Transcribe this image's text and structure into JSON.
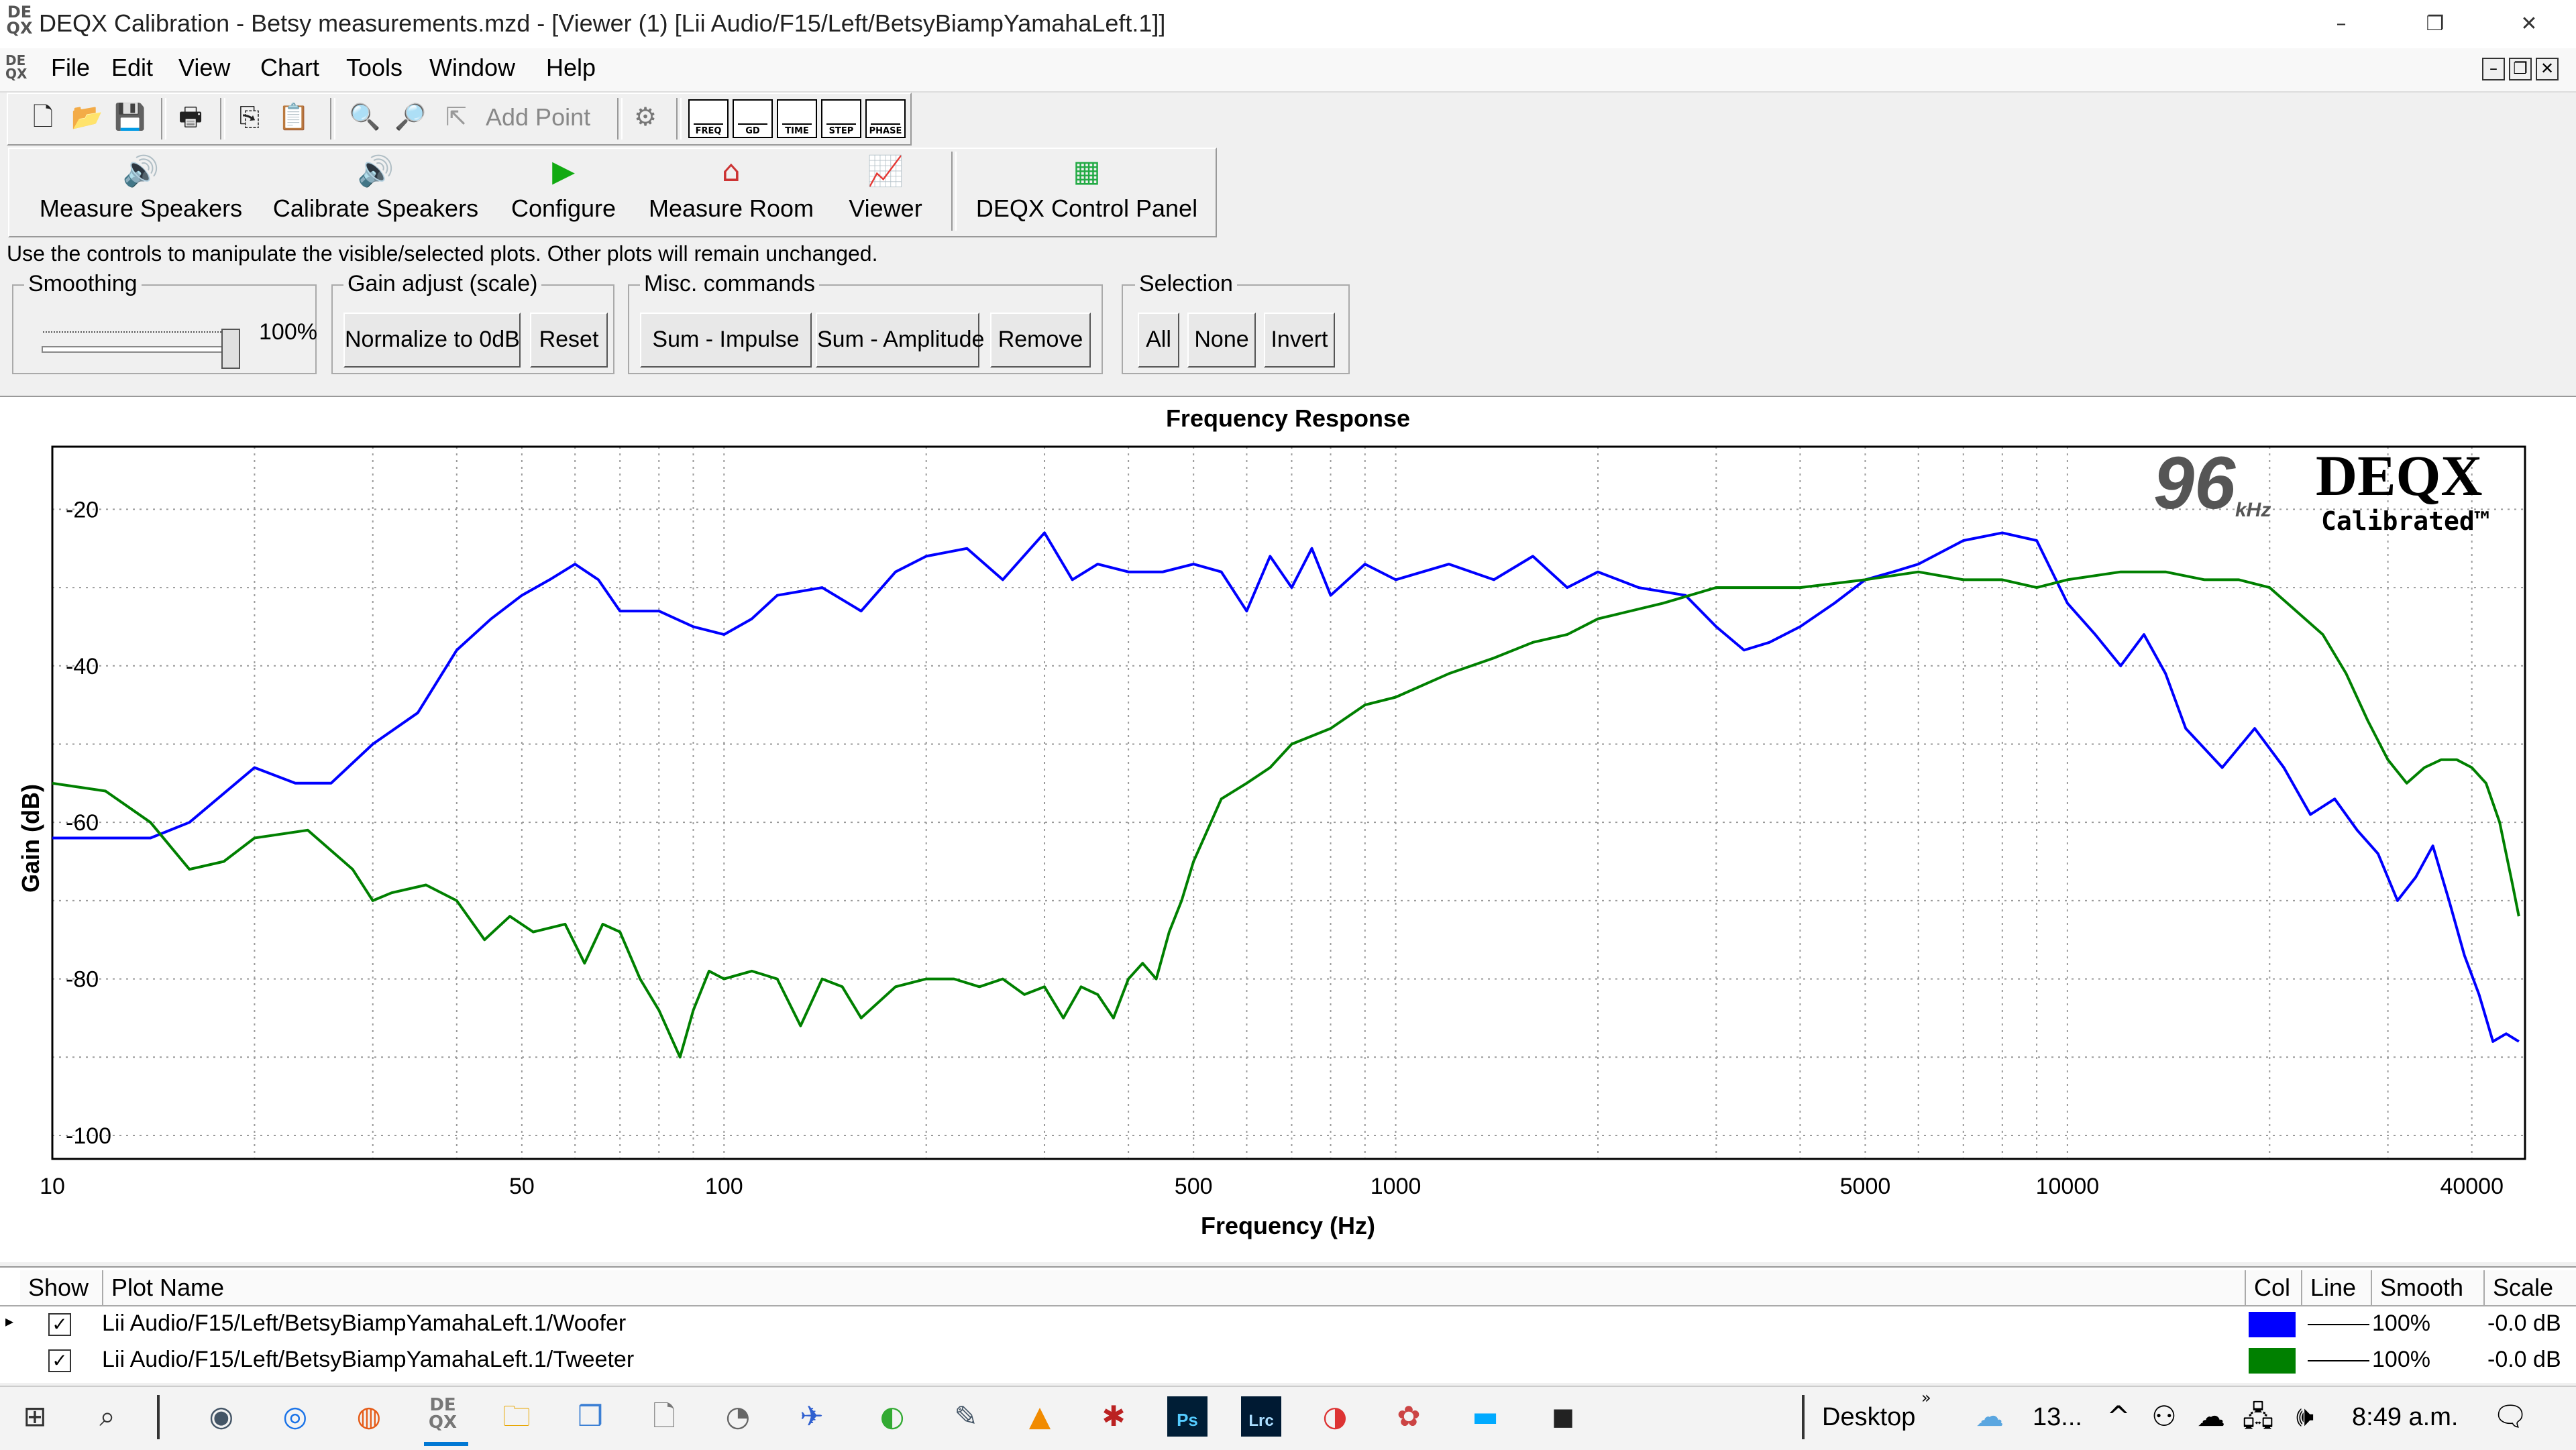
{
  "window": {
    "title": "DEQX Calibration - Betsy measurements.mzd - [Viewer (1) [Lii Audio/F15/Left/BetsyBiampYamahaLeft.1]]",
    "app_icon_text": "DE QX",
    "controls": [
      "–",
      "❐",
      "✕"
    ]
  },
  "menu": [
    "File",
    "Edit",
    "View",
    "Chart",
    "Tools",
    "Window",
    "Help"
  ],
  "toolbar": {
    "add_point_label": "Add Point",
    "view_buttons": [
      "FREQ",
      "GD",
      "TIME",
      "STEP",
      "PHASE"
    ]
  },
  "actions": [
    "Measure Speakers",
    "Calibrate Speakers",
    "Configure",
    "Measure Room",
    "Viewer",
    "DEQX Control Panel"
  ],
  "hint": "Use the controls to manipulate the visible/selected plots.  Other plots will remain unchanged.",
  "smoothing": {
    "title": "Smoothing",
    "value_label": "100%",
    "value": 1.0
  },
  "gain": {
    "title": "Gain adjust (scale)",
    "normalize": "Normalize to 0dB",
    "reset": "Reset"
  },
  "misc": {
    "title": "Misc. commands",
    "sum_impulse": "Sum - Impulse",
    "sum_amplitude": "Sum - Amplitude",
    "remove": "Remove"
  },
  "selection": {
    "title": "Selection",
    "all": "All",
    "none": "None",
    "invert": "Invert"
  },
  "chart_data": {
    "type": "line",
    "title": "Frequency Response",
    "xlabel": "Frequency (Hz)",
    "ylabel": "Gain (dB)",
    "x_scale": "log",
    "xlim": [
      10,
      48000
    ],
    "ylim": [
      -103,
      -12
    ],
    "x_ticks": [
      10,
      50,
      100,
      500,
      1000,
      5000,
      10000,
      40000
    ],
    "y_ticks": [
      -20,
      -40,
      -60,
      -80,
      -100
    ],
    "grid": true,
    "badge": {
      "rate": "96",
      "unit": "kHz",
      "brand": "DEQX",
      "sub": "Calibrated™"
    },
    "series": [
      {
        "name": "Lii Audio/F15/Left/BetsyBiampYamahaLeft.1/Woofer",
        "color": "#0000ff",
        "points": [
          [
            10,
            -62
          ],
          [
            14,
            -62
          ],
          [
            16,
            -60
          ],
          [
            20,
            -53
          ],
          [
            23,
            -55
          ],
          [
            26,
            -55
          ],
          [
            30,
            -50
          ],
          [
            35,
            -46
          ],
          [
            40,
            -38
          ],
          [
            45,
            -34
          ],
          [
            50,
            -31
          ],
          [
            55,
            -29
          ],
          [
            60,
            -27
          ],
          [
            65,
            -29
          ],
          [
            70,
            -33
          ],
          [
            80,
            -33
          ],
          [
            90,
            -35
          ],
          [
            100,
            -36
          ],
          [
            110,
            -34
          ],
          [
            120,
            -31
          ],
          [
            140,
            -30
          ],
          [
            160,
            -33
          ],
          [
            180,
            -28
          ],
          [
            200,
            -26
          ],
          [
            230,
            -25
          ],
          [
            260,
            -29
          ],
          [
            300,
            -23
          ],
          [
            330,
            -29
          ],
          [
            360,
            -27
          ],
          [
            400,
            -28
          ],
          [
            450,
            -28
          ],
          [
            500,
            -27
          ],
          [
            550,
            -28
          ],
          [
            600,
            -33
          ],
          [
            650,
            -26
          ],
          [
            700,
            -30
          ],
          [
            750,
            -25
          ],
          [
            800,
            -31
          ],
          [
            900,
            -27
          ],
          [
            1000,
            -29
          ],
          [
            1200,
            -27
          ],
          [
            1400,
            -29
          ],
          [
            1600,
            -26
          ],
          [
            1800,
            -30
          ],
          [
            2000,
            -28
          ],
          [
            2300,
            -30
          ],
          [
            2700,
            -31
          ],
          [
            3000,
            -35
          ],
          [
            3300,
            -38
          ],
          [
            3600,
            -37
          ],
          [
            4000,
            -35
          ],
          [
            4500,
            -32
          ],
          [
            5000,
            -29
          ],
          [
            5500,
            -28
          ],
          [
            6000,
            -27
          ],
          [
            7000,
            -24
          ],
          [
            8000,
            -23
          ],
          [
            9000,
            -24
          ],
          [
            10000,
            -32
          ],
          [
            11000,
            -36
          ],
          [
            12000,
            -40
          ],
          [
            13000,
            -36
          ],
          [
            14000,
            -41
          ],
          [
            15000,
            -48
          ],
          [
            17000,
            -53
          ],
          [
            19000,
            -48
          ],
          [
            21000,
            -53
          ],
          [
            23000,
            -59
          ],
          [
            25000,
            -57
          ],
          [
            27000,
            -61
          ],
          [
            29000,
            -64
          ],
          [
            31000,
            -70
          ],
          [
            33000,
            -67
          ],
          [
            35000,
            -63
          ],
          [
            37000,
            -70
          ],
          [
            39000,
            -77
          ],
          [
            41000,
            -82
          ],
          [
            43000,
            -88
          ],
          [
            45000,
            -87
          ],
          [
            47000,
            -88
          ]
        ]
      },
      {
        "name": "Lii Audio/F15/Left/BetsyBiampYamahaLeft.1/Tweeter",
        "color": "#008000",
        "points": [
          [
            10,
            -55
          ],
          [
            12,
            -56
          ],
          [
            14,
            -60
          ],
          [
            16,
            -66
          ],
          [
            18,
            -65
          ],
          [
            20,
            -62
          ],
          [
            24,
            -61
          ],
          [
            28,
            -66
          ],
          [
            30,
            -70
          ],
          [
            32,
            -69
          ],
          [
            36,
            -68
          ],
          [
            40,
            -70
          ],
          [
            44,
            -75
          ],
          [
            48,
            -72
          ],
          [
            52,
            -74
          ],
          [
            58,
            -73
          ],
          [
            62,
            -78
          ],
          [
            66,
            -73
          ],
          [
            70,
            -74
          ],
          [
            75,
            -80
          ],
          [
            80,
            -84
          ],
          [
            86,
            -90
          ],
          [
            90,
            -84
          ],
          [
            95,
            -79
          ],
          [
            100,
            -80
          ],
          [
            110,
            -79
          ],
          [
            120,
            -80
          ],
          [
            130,
            -86
          ],
          [
            140,
            -80
          ],
          [
            150,
            -81
          ],
          [
            160,
            -85
          ],
          [
            180,
            -81
          ],
          [
            200,
            -80
          ],
          [
            220,
            -80
          ],
          [
            240,
            -81
          ],
          [
            260,
            -80
          ],
          [
            280,
            -82
          ],
          [
            300,
            -81
          ],
          [
            320,
            -85
          ],
          [
            340,
            -81
          ],
          [
            360,
            -82
          ],
          [
            380,
            -85
          ],
          [
            400,
            -80
          ],
          [
            420,
            -78
          ],
          [
            440,
            -80
          ],
          [
            460,
            -74
          ],
          [
            480,
            -70
          ],
          [
            500,
            -65
          ],
          [
            550,
            -57
          ],
          [
            600,
            -55
          ],
          [
            650,
            -53
          ],
          [
            700,
            -50
          ],
          [
            800,
            -48
          ],
          [
            900,
            -45
          ],
          [
            1000,
            -44
          ],
          [
            1200,
            -41
          ],
          [
            1400,
            -39
          ],
          [
            1600,
            -37
          ],
          [
            1800,
            -36
          ],
          [
            2000,
            -34
          ],
          [
            2500,
            -32
          ],
          [
            3000,
            -30
          ],
          [
            4000,
            -30
          ],
          [
            5000,
            -29
          ],
          [
            6000,
            -28
          ],
          [
            7000,
            -29
          ],
          [
            8000,
            -29
          ],
          [
            9000,
            -30
          ],
          [
            10000,
            -29
          ],
          [
            12000,
            -28
          ],
          [
            14000,
            -28
          ],
          [
            16000,
            -29
          ],
          [
            18000,
            -29
          ],
          [
            20000,
            -30
          ],
          [
            24000,
            -36
          ],
          [
            26000,
            -41
          ],
          [
            28000,
            -47
          ],
          [
            30000,
            -52
          ],
          [
            32000,
            -55
          ],
          [
            34000,
            -53
          ],
          [
            36000,
            -52
          ],
          [
            38000,
            -52
          ],
          [
            40000,
            -53
          ],
          [
            42000,
            -55
          ],
          [
            44000,
            -60
          ],
          [
            46000,
            -68
          ],
          [
            47000,
            -72
          ]
        ]
      }
    ]
  },
  "list": {
    "headers": [
      "Show",
      "Plot Name",
      "Col",
      "Line",
      "Smooth",
      "Scale"
    ],
    "rows": [
      {
        "name": "Lii Audio/F15/Left/BetsyBiampYamahaLeft.1/Woofer",
        "color": "#0000ff",
        "smooth": "100%",
        "scale": "-0.0 dB",
        "checked": true
      },
      {
        "name": "Lii Audio/F15/Left/BetsyBiampYamahaLeft.1/Tweeter",
        "color": "#008000",
        "smooth": "100%",
        "scale": "-0.0 dB",
        "checked": true
      }
    ]
  },
  "taskbar": {
    "desktop_label": "Desktop",
    "weather": "13...",
    "time": "8:49 a.m."
  }
}
